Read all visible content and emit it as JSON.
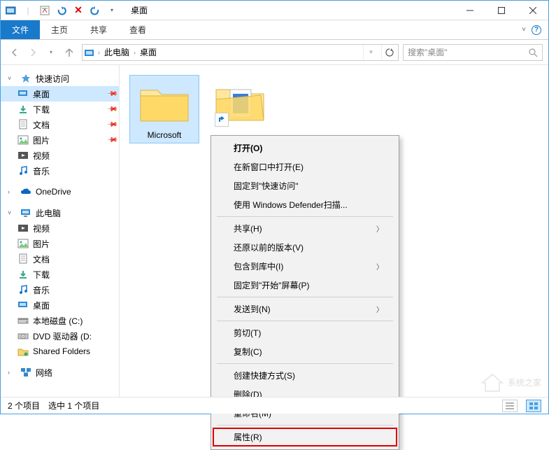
{
  "titlebar": {
    "title": "桌面"
  },
  "ribbon": {
    "file": "文件",
    "tabs": [
      "主页",
      "共享",
      "查看"
    ]
  },
  "breadcrumb": {
    "root": "此电脑",
    "current": "桌面"
  },
  "search": {
    "placeholder": "搜索\"桌面\""
  },
  "sidebar": {
    "quick_access": {
      "label": "快速访问",
      "items": [
        {
          "label": "桌面",
          "pinned": true,
          "icon": "desktop"
        },
        {
          "label": "下载",
          "pinned": true,
          "icon": "downloads"
        },
        {
          "label": "文档",
          "pinned": true,
          "icon": "documents"
        },
        {
          "label": "图片",
          "pinned": true,
          "icon": "pictures"
        },
        {
          "label": "视频",
          "pinned": false,
          "icon": "videos"
        },
        {
          "label": "音乐",
          "pinned": false,
          "icon": "music"
        }
      ]
    },
    "onedrive": {
      "label": "OneDrive"
    },
    "this_pc": {
      "label": "此电脑",
      "items": [
        {
          "label": "视频",
          "icon": "videos"
        },
        {
          "label": "图片",
          "icon": "pictures"
        },
        {
          "label": "文档",
          "icon": "documents"
        },
        {
          "label": "下载",
          "icon": "downloads"
        },
        {
          "label": "音乐",
          "icon": "music"
        },
        {
          "label": "桌面",
          "icon": "desktop"
        },
        {
          "label": "本地磁盘 (C:)",
          "icon": "drive"
        },
        {
          "label": "DVD 驱动器 (D:",
          "icon": "dvd"
        },
        {
          "label": "Shared Folders",
          "icon": "netfolder"
        }
      ]
    },
    "network": {
      "label": "网络"
    }
  },
  "content": {
    "items": [
      {
        "label": "Microsoft",
        "type": "folder",
        "selected": true
      },
      {
        "label": "",
        "type": "shortcut-docs",
        "selected": false
      }
    ]
  },
  "context_menu": {
    "items": [
      {
        "label": "打开(O)",
        "bold": true
      },
      {
        "label": "在新窗口中打开(E)"
      },
      {
        "label": "固定到\"快速访问\""
      },
      {
        "label": "使用 Windows Defender扫描..."
      },
      {
        "sep": true
      },
      {
        "label": "共享(H)",
        "submenu": true
      },
      {
        "label": "还原以前的版本(V)"
      },
      {
        "label": "包含到库中(I)",
        "submenu": true
      },
      {
        "label": "固定到\"开始\"屏幕(P)"
      },
      {
        "sep": true
      },
      {
        "label": "发送到(N)",
        "submenu": true
      },
      {
        "sep": true
      },
      {
        "label": "剪切(T)"
      },
      {
        "label": "复制(C)"
      },
      {
        "sep": true
      },
      {
        "label": "创建快捷方式(S)"
      },
      {
        "label": "删除(D)"
      },
      {
        "label": "重命名(M)"
      },
      {
        "sep": true
      },
      {
        "label": "属性(R)",
        "highlighted": true
      }
    ]
  },
  "statusbar": {
    "count": "2 个项目",
    "selected": "选中 1 个项目"
  },
  "watermark": "系统之家"
}
